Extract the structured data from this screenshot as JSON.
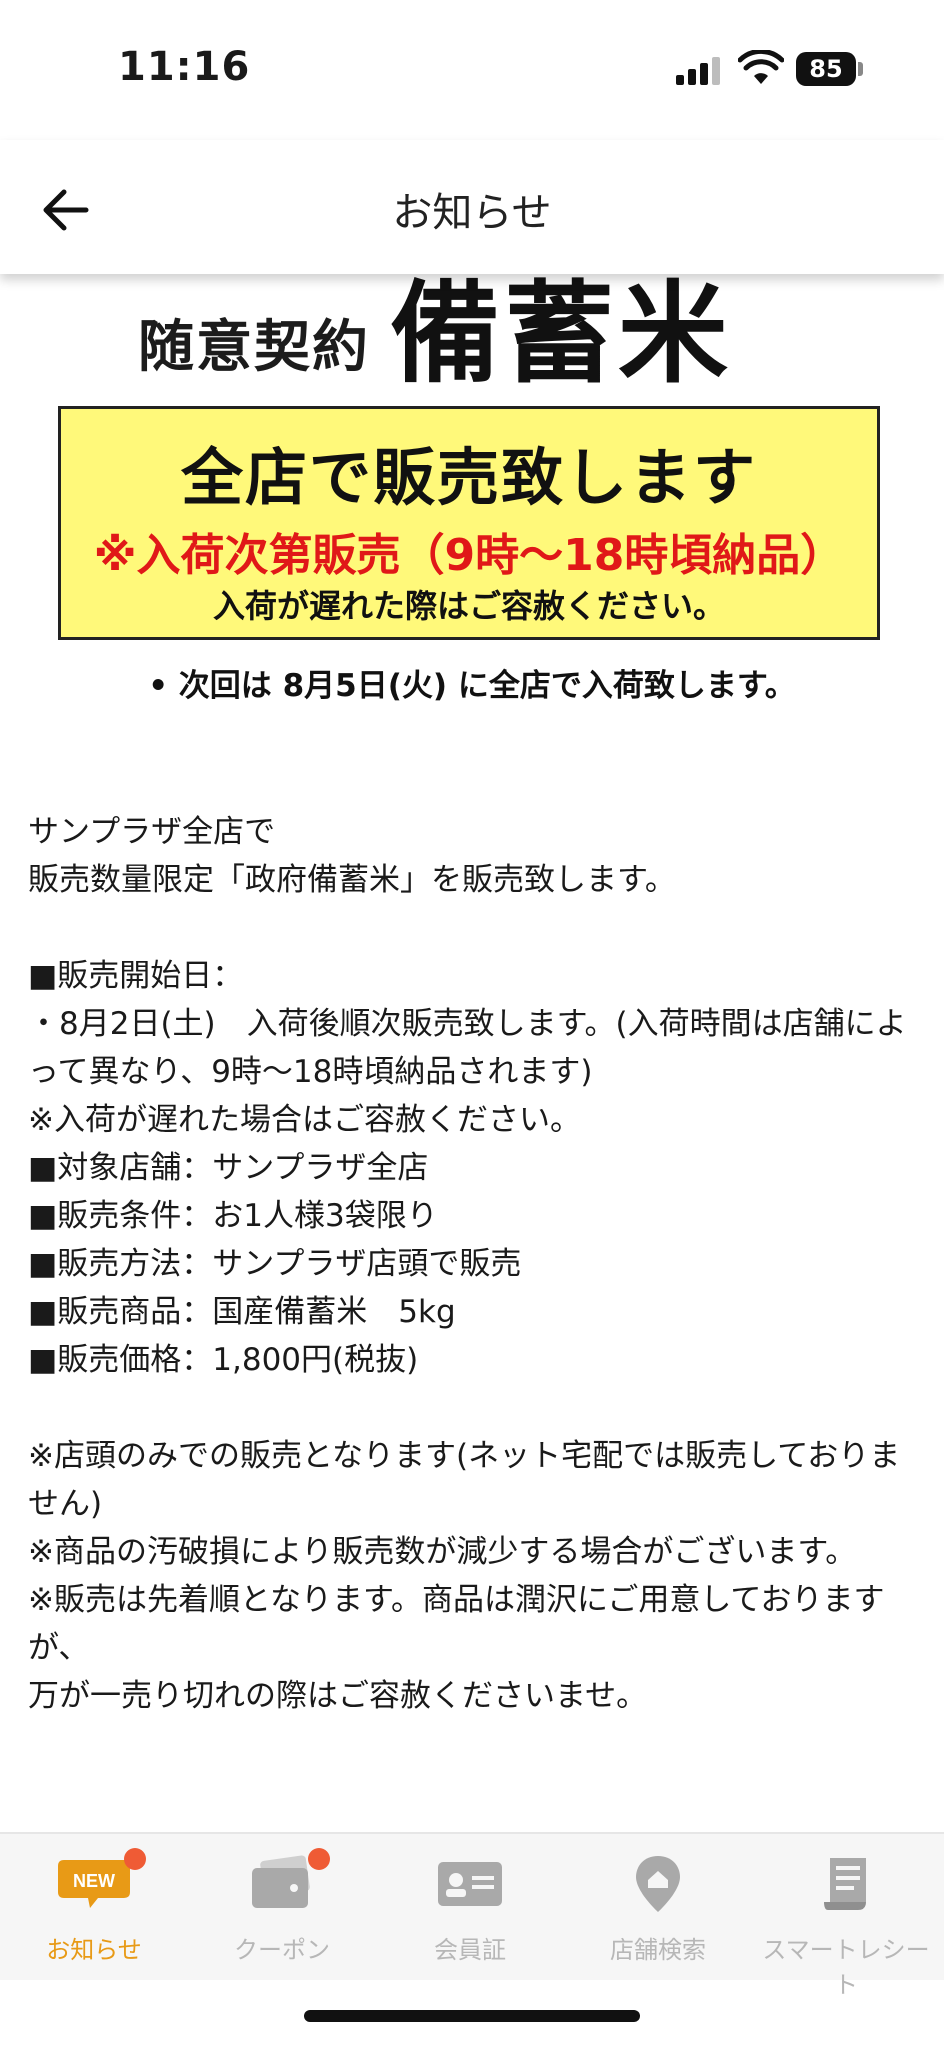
{
  "status_bar": {
    "time": "11:16",
    "battery": "85"
  },
  "header": {
    "title": "お知らせ"
  },
  "banner": {
    "prefix": "随意契約",
    "headline": "備蓄米",
    "line1": "全店で販売致します",
    "line2": "※入荷次第販売（9時〜18時頃納品）",
    "line3": "入荷が遅れた際はご容赦ください。",
    "next": "• 次回は 8月5日(火) に全店で入荷致します。"
  },
  "body": [
    "サンプラザ全店で",
    "販売数量限定「政府備蓄米」を販売致します。",
    "",
    "■販売開始日：",
    "・8月2日(土)　入荷後順次販売致します。(入荷時間は店舗によって異なり、9時〜18時頃納品されます)",
    "※入荷が遅れた場合はご容赦ください。",
    "■対象店舗：サンプラザ全店",
    "■販売条件：お1人様3袋限り",
    "■販売方法：サンプラザ店頭で販売",
    "■販売商品：国産備蓄米　5kg",
    "■販売価格：1,800円(税抜)",
    "",
    "※店頭のみでの販売となります(ネット宅配では販売しておりません)",
    "※商品の汚破損により販売数が減少する場合がございます。",
    "※販売は先着順となります。商品は潤沢にご用意しておりますが、",
    "万が一売り切れの際はご容赦くださいませ。"
  ],
  "tabs": [
    {
      "label": "お知らせ",
      "icon": "new-badge-icon",
      "active": true,
      "badge": true,
      "icon_text": "NEW"
    },
    {
      "label": "クーポン",
      "icon": "coupon-icon",
      "active": false,
      "badge": true
    },
    {
      "label": "会員証",
      "icon": "member-card-icon",
      "active": false,
      "badge": false
    },
    {
      "label": "店舗検索",
      "icon": "store-pin-icon",
      "active": false,
      "badge": false
    },
    {
      "label": "スマートレシート",
      "icon": "receipt-icon",
      "active": false,
      "badge": false
    }
  ],
  "colors": {
    "accent": "#e89a16",
    "badge": "#ef5b35",
    "banner_yellow": "#fff97a",
    "banner_red": "#e01818"
  }
}
